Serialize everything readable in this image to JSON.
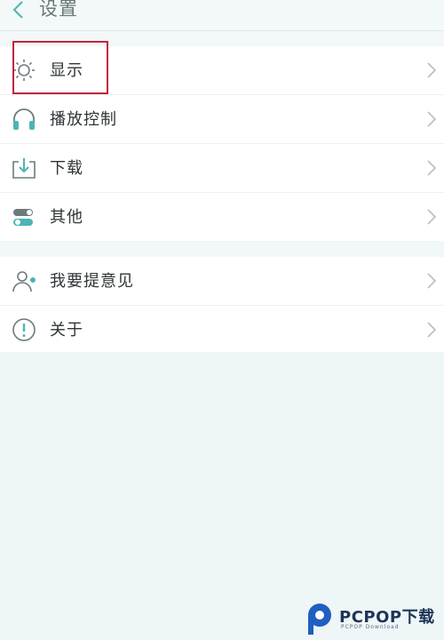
{
  "header": {
    "title": "设置",
    "back_icon": "chevron-left-icon"
  },
  "groups": [
    {
      "items": [
        {
          "label": "显示",
          "icon": "sun-icon"
        },
        {
          "label": "播放控制",
          "icon": "headphones-icon"
        },
        {
          "label": "下载",
          "icon": "download-tray-icon"
        },
        {
          "label": "其他",
          "icon": "toggles-icon"
        }
      ]
    },
    {
      "items": [
        {
          "label": "我要提意见",
          "icon": "user-feedback-icon"
        },
        {
          "label": "关于",
          "icon": "info-circle-icon"
        }
      ]
    }
  ],
  "highlight": {
    "target": "显示",
    "color": "#c3253c"
  },
  "watermark": {
    "brand": "PCPOP下载",
    "sub": "PCPOP Download"
  },
  "colors": {
    "accent": "#4fb3b3",
    "icon_gray": "#6d7a7d",
    "chevron": "#b8bfc1"
  }
}
